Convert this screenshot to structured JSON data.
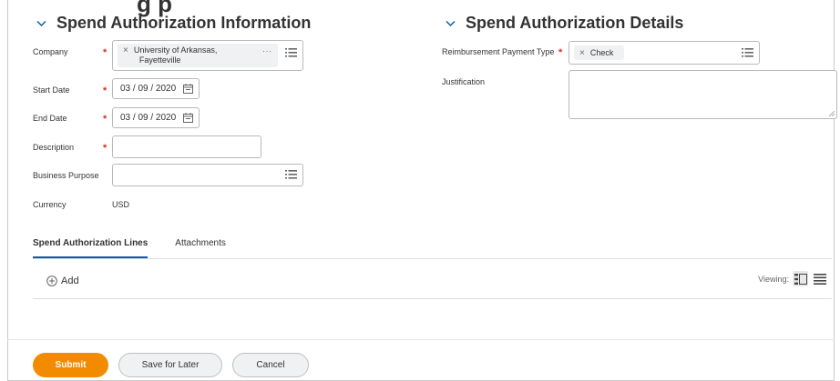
{
  "clipped_header": "g            p",
  "left_section": {
    "title": "Spend Authorization Information"
  },
  "right_section": {
    "title": "Spend Authorization Details"
  },
  "fields": {
    "company": {
      "label": "Company",
      "value_line1": "University of Arkansas,",
      "value_line2": "Fayetteville",
      "more": "···"
    },
    "start_date": {
      "label": "Start Date",
      "value": "03 / 09 / 2020"
    },
    "end_date": {
      "label": "End Date",
      "value": "03 / 09 / 2020"
    },
    "description": {
      "label": "Description",
      "value": ""
    },
    "business_purpose": {
      "label": "Business Purpose",
      "value": ""
    },
    "currency": {
      "label": "Currency",
      "value": "USD"
    },
    "reimbursement_payment_type": {
      "label": "Reimbursement Payment Type",
      "value": "Check"
    },
    "justification": {
      "label": "Justification",
      "value": ""
    }
  },
  "required_marker": "*",
  "remove_glyph": "×",
  "tabs": [
    {
      "label": "Spend Authorization Lines",
      "active": true
    },
    {
      "label": "Attachments",
      "active": false
    }
  ],
  "lines": {
    "add_label": "Add",
    "viewing_label": "Viewing:"
  },
  "footer": {
    "submit": "Submit",
    "save_for_later": "Save for Later",
    "cancel": "Cancel"
  },
  "colors": {
    "accent_orange": "#f38b00",
    "active_tab": "#0b5ca8",
    "required": "#de2e21"
  },
  "icons": [
    "chevron-down-icon",
    "remove-icon",
    "list-prompt-icon",
    "calendar-icon",
    "add-circle-icon",
    "grid-view-icon",
    "list-view-icon"
  ]
}
